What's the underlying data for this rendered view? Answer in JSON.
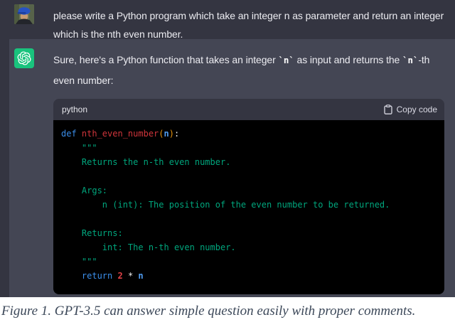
{
  "user_message": {
    "text": "please write a Python program which take an integer n as parameter and return an integer which is the nth even number."
  },
  "assistant_message": {
    "part1": "Sure, here's a Python function that takes an integer ",
    "code1": "`n`",
    "part2": " as input and returns the ",
    "code2": "`n`",
    "part3": "-th even number:"
  },
  "code_block": {
    "language_label": "python",
    "copy_button_label": "Copy code",
    "lines": [
      [
        {
          "t": "def ",
          "c": "kw"
        },
        {
          "t": "nth_even_number",
          "c": "fn"
        },
        {
          "t": "(",
          "c": "pr"
        },
        {
          "t": "n",
          "c": "var"
        },
        {
          "t": ")",
          "c": "pr"
        },
        {
          "t": ":",
          "c": "pl"
        }
      ],
      [
        {
          "t": "    \"\"\"",
          "c": "str"
        }
      ],
      [
        {
          "t": "    Returns the n-th even number.",
          "c": "str"
        }
      ],
      [
        {
          "t": "",
          "c": "pl"
        }
      ],
      [
        {
          "t": "    Args:",
          "c": "str"
        }
      ],
      [
        {
          "t": "        n (int): The position of the even number to be returned.",
          "c": "str"
        }
      ],
      [
        {
          "t": "",
          "c": "pl"
        }
      ],
      [
        {
          "t": "    Returns:",
          "c": "str"
        }
      ],
      [
        {
          "t": "        int: The n-th even number.",
          "c": "str"
        }
      ],
      [
        {
          "t": "    \"\"\"",
          "c": "str"
        }
      ],
      [
        {
          "t": "    ",
          "c": "pl"
        },
        {
          "t": "return ",
          "c": "kw"
        },
        {
          "t": "2",
          "c": "num"
        },
        {
          "t": " * ",
          "c": "op"
        },
        {
          "t": "n",
          "c": "var"
        }
      ]
    ]
  },
  "caption": {
    "text": "Figure 1. GPT-3.5 can answer simple question easily with proper comments."
  },
  "icons": {
    "user_avatar": "user-photo-avatar",
    "assistant_avatar": "openai-logo",
    "copy": "clipboard-icon"
  },
  "colors": {
    "page_bg": "#343541",
    "assistant_row_bg": "#444654",
    "code_bg": "#000000",
    "code_header_bg": "#343541",
    "accent_green": "#19c37d",
    "message_text": "#ececf1",
    "header_text": "#d9d9e3",
    "caption_text": "#3c4859",
    "token_keyword": "#3b8eea",
    "token_function": "#d0353b",
    "token_paren": "#e9950c",
    "token_string": "#00a67d",
    "token_number": "#e04146",
    "token_variable": "#4f9cf0"
  }
}
